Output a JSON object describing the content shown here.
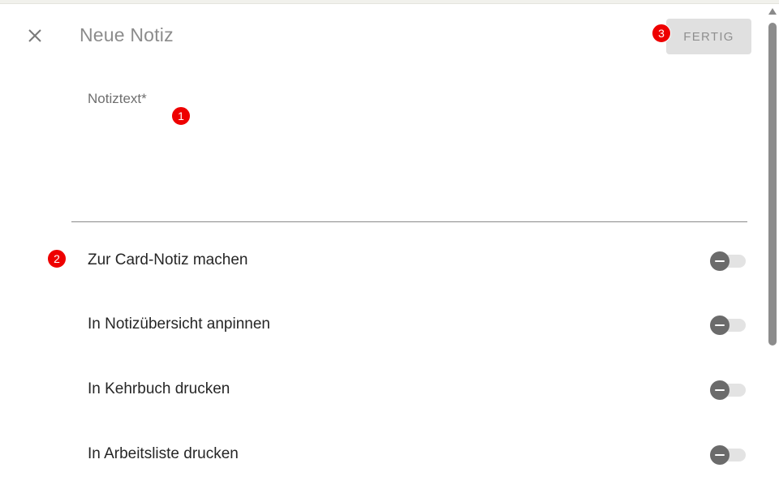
{
  "header": {
    "title": "Neue Notiz",
    "close_icon": "close-icon",
    "done_label": "FERTIG"
  },
  "note": {
    "label": "Notiztext*",
    "value": ""
  },
  "options": [
    {
      "label": "Zur Card-Notiz machen",
      "checked": false
    },
    {
      "label": "In Notizübersicht anpinnen",
      "checked": false
    },
    {
      "label": "In Kehrbuch drucken",
      "checked": false
    },
    {
      "label": "In Arbeitsliste drucken",
      "checked": false
    }
  ],
  "markers": [
    "1",
    "2",
    "3"
  ],
  "colors": {
    "marker": "#ee0000",
    "toggle_knob": "#6b6b6b",
    "toggle_track": "#e3e3e3",
    "done_button_bg": "#e0e0e0"
  }
}
